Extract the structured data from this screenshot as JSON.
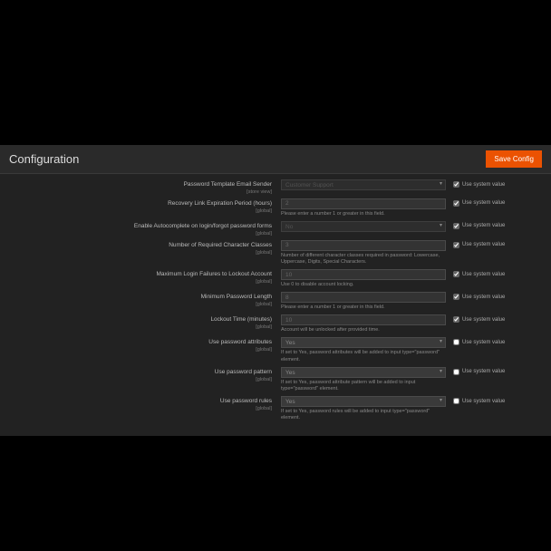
{
  "header": {
    "title": "Configuration",
    "save": "Save Config"
  },
  "sys": "Use system value",
  "scope": "[global]",
  "scope_sv": "[store view]",
  "rows": {
    "sender": {
      "label": "Password Template Email Sender",
      "value": "Customer Support"
    },
    "recovery": {
      "label": "Recovery Link Expiration Period (hours)",
      "value": "2",
      "hint": "Please enter a number 1 or greater in this field."
    },
    "autocomplete": {
      "label": "Enable Autocomplete on login/forgot password forms",
      "value": "No"
    },
    "classes": {
      "label": "Number of Required Character Classes",
      "value": "3",
      "hint": "Number of different character classes required in password: Lowercase, Uppercase, Digits, Special Characters."
    },
    "lockout": {
      "label": "Maximum Login Failures to Lockout Account",
      "value": "10",
      "hint": "Use 0 to disable account locking."
    },
    "minlen": {
      "label": "Minimum Password Length",
      "value": "8",
      "hint": "Please enter a number 1 or greater in this field."
    },
    "locktime": {
      "label": "Lockout Time (minutes)",
      "value": "10",
      "hint": "Account will be unlocked after provided time."
    },
    "pwattr": {
      "label": "Use password attributes",
      "value": "Yes",
      "hint": "If set to Yes, password attributes will be added to input type=\"password\" element."
    },
    "pwpattern": {
      "label": "Use password pattern",
      "value": "Yes",
      "hint": "If set to Yes, password attribute pattern will be added to input type=\"password\" element."
    },
    "pwrules": {
      "label": "Use password rules",
      "value": "Yes",
      "hint": "If set to Yes, password rules will be added to input type=\"password\" element."
    }
  }
}
